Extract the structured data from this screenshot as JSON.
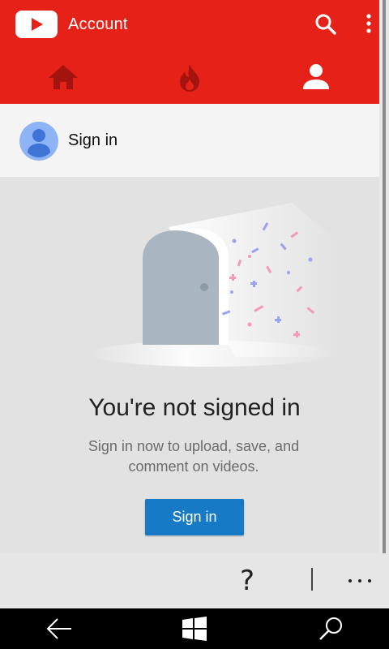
{
  "app": {
    "title": "Account"
  },
  "header": {
    "search_icon": "search-icon",
    "more_icon": "more-vertical-icon",
    "tabs": [
      {
        "name": "home",
        "icon": "home-icon",
        "selected": false
      },
      {
        "name": "trending",
        "icon": "flame-icon",
        "selected": false
      },
      {
        "name": "account",
        "icon": "person-icon",
        "selected": true
      }
    ]
  },
  "signin_row": {
    "label": "Sign in",
    "icon": "avatar-icon"
  },
  "empty_state": {
    "heading": "You're not signed in",
    "subtext": "Sign in now to upload, save, and comment on videos.",
    "button_label": "Sign in",
    "illustration": "open-door-with-confetti"
  },
  "appbar": {
    "help_glyph": "?",
    "more_icon": "more-horizontal-icon"
  },
  "system_nav": {
    "back_icon": "back-arrow-icon",
    "start_icon": "windows-logo-icon",
    "search_icon": "search-icon"
  },
  "colors": {
    "header_red": "#e62117",
    "tab_inactive": "#a3140e",
    "button_blue": "#167ac6",
    "background": "#e2e2e2"
  }
}
